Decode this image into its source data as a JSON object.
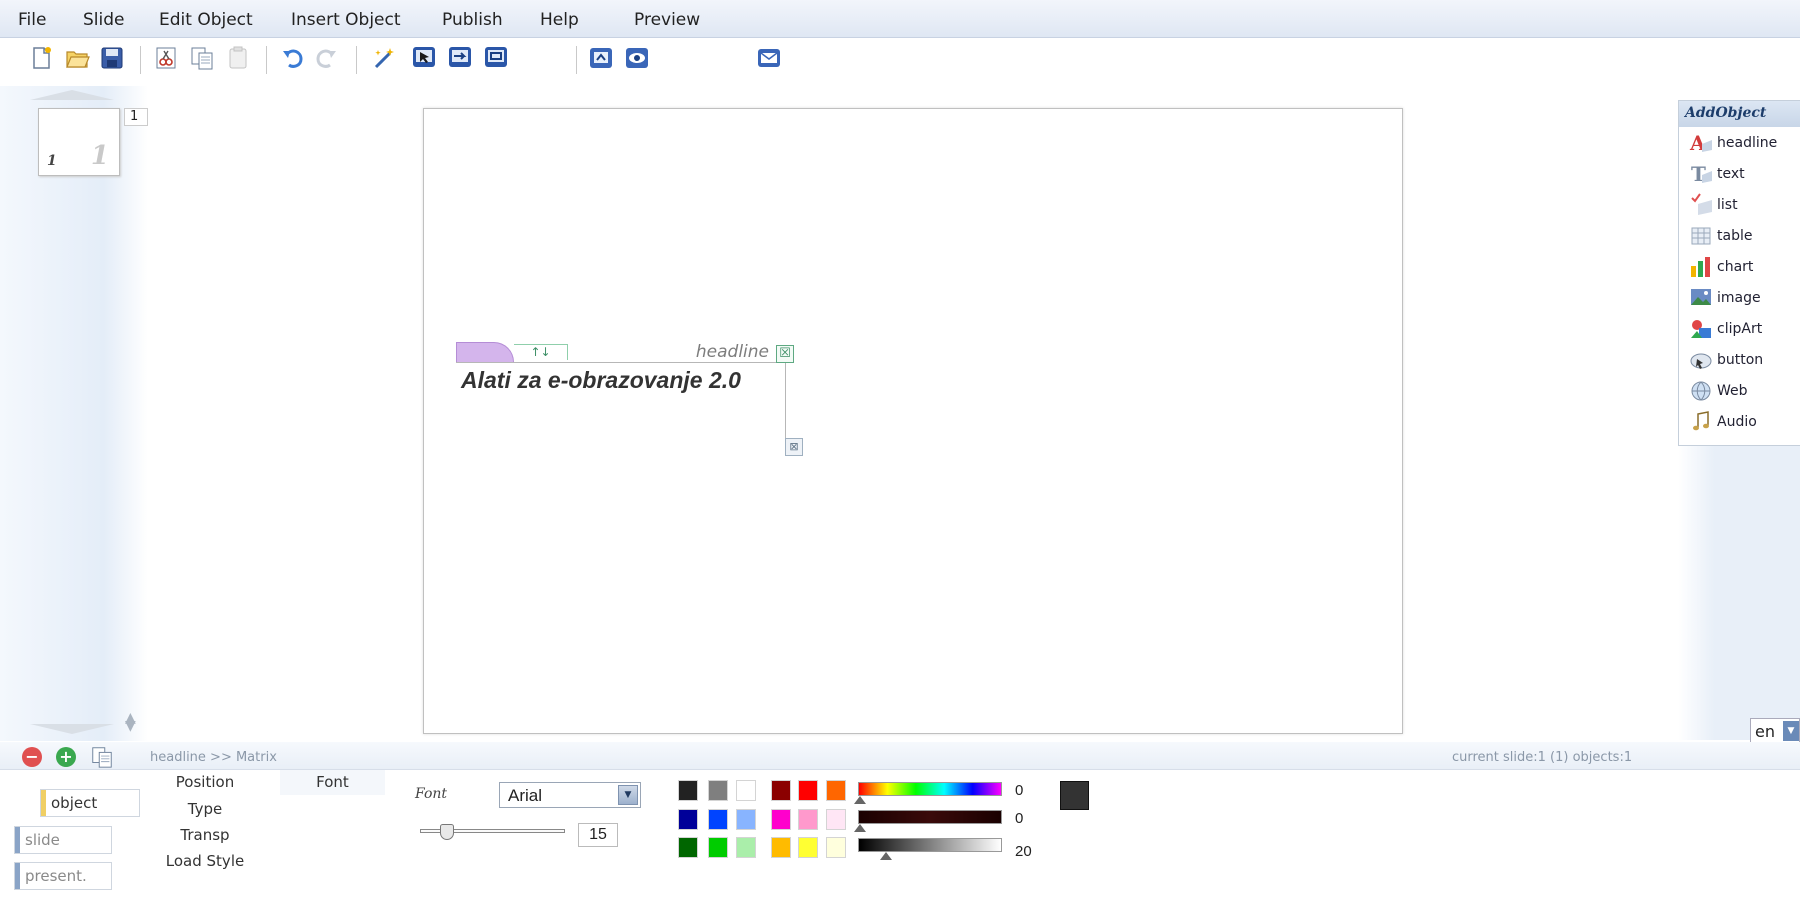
{
  "menu": [
    "File",
    "Slide",
    "Edit Object",
    "Insert Object",
    "Publish",
    "Help",
    "Preview"
  ],
  "toolbar": {
    "icons": [
      "new-file-icon",
      "open-folder-icon",
      "save-icon",
      "cut-icon",
      "copy-icon",
      "paste-icon",
      "undo-icon",
      "redo-icon",
      "edit-wand-icon",
      "select-object-icon",
      "move-object-icon",
      "frame-object-icon",
      "publish-icon",
      "preview-eye-icon",
      "email-icon"
    ]
  },
  "slides": {
    "thumbnail_page": "1",
    "thumbnail_watermark": "1",
    "count": "1"
  },
  "canvas": {
    "headline_label": "headline",
    "headline_text": "Alati za e-obrazovanje 2.0",
    "close_glyph": "☒",
    "resize_glyph": "⊠",
    "arrows_glyph": "↑↓"
  },
  "add_object": {
    "title": "AddObject",
    "items": [
      "headline",
      "text",
      "list",
      "table",
      "chart",
      "image",
      "clipArt",
      "button",
      "Web",
      "Audio"
    ]
  },
  "language": "en",
  "bottom": {
    "breadcrumb": "headline >> Matrix",
    "status": "current slide:1 (1) objects:1",
    "side_buttons": [
      "object",
      "slide",
      "present."
    ],
    "property_tabs": [
      "Position",
      "Type",
      "Transp",
      "Load Style"
    ],
    "font_tab": "Font",
    "font_label": "Font",
    "font_value": "Arial",
    "font_size": "15",
    "font_size_fraction": 0.15,
    "gradient_values": [
      "0",
      "0",
      "20"
    ],
    "colors": {
      "row1": [
        "#222222",
        "#7f7f7f",
        "#ffffff",
        "#8b0000",
        "#ff0000",
        "#ff6600"
      ],
      "row2": [
        "#000099",
        "#0044ff",
        "#88b4ff",
        "#ff00cc",
        "#ff99cc",
        "#ffe6f5"
      ],
      "row3": [
        "#006600",
        "#00cc00",
        "#aaeeaa",
        "#ffbb00",
        "#ffff33",
        "#ffffdd"
      ],
      "selected": "#333333"
    }
  }
}
